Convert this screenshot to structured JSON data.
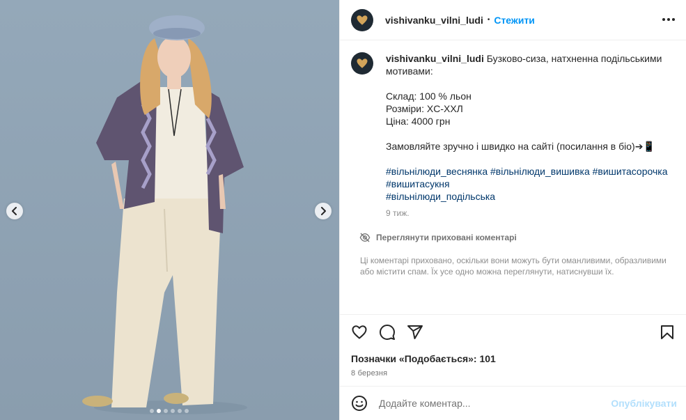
{
  "post": {
    "username": "vishivanku_vilni_ludi",
    "follow_label": "Стежити",
    "separator": "•"
  },
  "caption": {
    "username": "vishivanku_vilni_ludi",
    "lines": [
      "Бузково-сиза, натхненна подільськими мотивами:",
      "Склад: 100 % льон",
      "Розміри: XC-XXЛ",
      "Ціна: 4000 грн",
      "Замовляйте зручно і швидко на сайті (посилання в біо)➔📱"
    ],
    "hashtags": [
      "#вільнілюди_веснянка",
      "#вільнілюди_вишивка",
      "#вишитасорочка",
      "#вишитасукня",
      "#вільнілюди_подільська"
    ],
    "time": "9 тиж."
  },
  "hidden_comments": {
    "label": "Переглянути приховані коментарі",
    "note": "Ці коментарі приховано, оскільки вони можуть бути оманливими, образливими або містити спам. Їх усе одно можна переглянути, натиснувши їх."
  },
  "engagement": {
    "likes_text": "Позначки «Подобається»: 101",
    "date": "8 березня"
  },
  "comment_box": {
    "placeholder": "Додайте коментар...",
    "publish_label": "Опублікувати"
  },
  "carousel": {
    "total_slides": 6,
    "active_slide": 2
  },
  "colors": {
    "accent": "#0095f6",
    "publish_disabled": "#b2dffc",
    "hashtag": "#00376b",
    "background_photo": "#8fa2b3"
  },
  "icons": [
    "chevron-left-icon",
    "chevron-right-icon",
    "more-icon",
    "heart-icon",
    "comment-icon",
    "share-icon",
    "bookmark-icon",
    "eye-off-icon",
    "emoji-icon"
  ]
}
